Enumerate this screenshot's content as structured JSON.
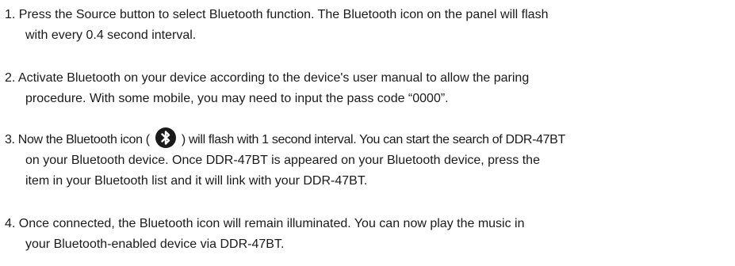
{
  "steps": [
    {
      "number": "1.",
      "lines": [
        "Press the Source button to select Bluetooth function. The Bluetooth icon on the panel will flash",
        "with every 0.4 second interval."
      ]
    },
    {
      "number": "2.",
      "lines": [
        "Activate Bluetooth on your device according to the device's user manual to allow the paring",
        "procedure. With some mobile, you may need to input the pass code “0000”."
      ]
    },
    {
      "number": "3.",
      "line1_before_icon": "Now the Bluetooth icon (",
      "line1_after_icon": ") will flash with 1 second interval. You can start the search of DDR-47BT",
      "lines": [
        "on your Bluetooth device. Once DDR-47BT is appeared on your Bluetooth device, press the",
        "item in your Bluetooth list and it will link with your DDR-47BT."
      ],
      "icon": "bluetooth-icon",
      "icon_color": "#1a1a1a"
    },
    {
      "number": "4.",
      "lines": [
        "Once connected, the Bluetooth icon will remain illuminated. You can now play the music in",
        "your Bluetooth-enabled device via DDR-47BT."
      ]
    }
  ]
}
